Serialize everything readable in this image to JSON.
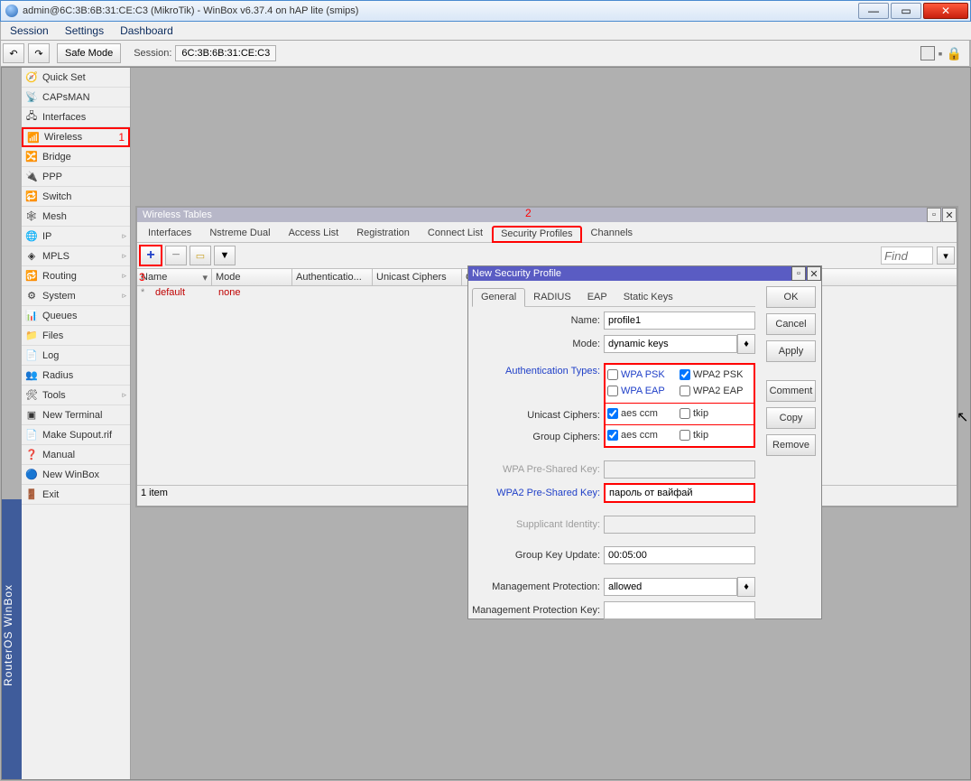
{
  "window": {
    "title": "admin@6C:3B:6B:31:CE:C3 (MikroTik) - WinBox v6.37.4 on hAP lite (smips)"
  },
  "menubar": [
    "Session",
    "Settings",
    "Dashboard"
  ],
  "toolbar": {
    "safe_mode": "Safe Mode",
    "session_label": "Session:",
    "session_value": "6C:3B:6B:31:CE:C3"
  },
  "vertical": "RouterOS WinBox",
  "sidebar": [
    {
      "label": "Quick Set"
    },
    {
      "label": "CAPsMAN"
    },
    {
      "label": "Interfaces"
    },
    {
      "label": "Wireless",
      "annot": "1",
      "highlight": true
    },
    {
      "label": "Bridge"
    },
    {
      "label": "PPP"
    },
    {
      "label": "Switch"
    },
    {
      "label": "Mesh"
    },
    {
      "label": "IP",
      "exp": true
    },
    {
      "label": "MPLS",
      "exp": true
    },
    {
      "label": "Routing",
      "exp": true
    },
    {
      "label": "System",
      "exp": true
    },
    {
      "label": "Queues"
    },
    {
      "label": "Files"
    },
    {
      "label": "Log"
    },
    {
      "label": "Radius"
    },
    {
      "label": "Tools",
      "exp": true
    },
    {
      "label": "New Terminal"
    },
    {
      "label": "Make Supout.rif"
    },
    {
      "label": "Manual"
    },
    {
      "label": "New WinBox"
    },
    {
      "label": "Exit"
    }
  ],
  "wt": {
    "title": "Wireless Tables",
    "annot": "2",
    "tabs": [
      "Interfaces",
      "Nstreme Dual",
      "Access List",
      "Registration",
      "Connect List",
      "Security Profiles",
      "Channels"
    ],
    "selected_tab": "Security Profiles",
    "find": "Find",
    "annot3": "3",
    "cols": [
      "Name",
      "Mode",
      "Authenticatio...",
      "Unicast Ciphers",
      "Group C"
    ],
    "row": {
      "marker": "*",
      "name": "default",
      "mode": "none"
    },
    "status": "1 item"
  },
  "nsp": {
    "title": "New Security Profile",
    "tabs": [
      "General",
      "RADIUS",
      "EAP",
      "Static Keys"
    ],
    "selected_tab": "General",
    "labels": {
      "name": "Name:",
      "mode": "Mode:",
      "auth": "Authentication Types:",
      "ucipher": "Unicast Ciphers:",
      "gcipher": "Group Ciphers:",
      "wpa": "WPA Pre-Shared Key:",
      "wpa2": "WPA2 Pre-Shared Key:",
      "supp": "Supplicant Identity:",
      "gku": "Group Key Update:",
      "mp": "Management Protection:",
      "mpk": "Management Protection Key:"
    },
    "values": {
      "name": "profile1",
      "mode": "dynamic keys",
      "wpa_psk": "WPA PSK",
      "wpa2_psk": "WPA2 PSK",
      "wpa_eap": "WPA EAP",
      "wpa2_eap": "WPA2 EAP",
      "aes": "aes ccm",
      "tkip": "tkip",
      "wpa2key": "пароль от вайфай",
      "gku": "00:05:00",
      "mp": "allowed"
    },
    "buttons": {
      "ok": "OK",
      "cancel": "Cancel",
      "apply": "Apply",
      "comment": "Comment",
      "copy": "Copy",
      "remove": "Remove"
    }
  }
}
